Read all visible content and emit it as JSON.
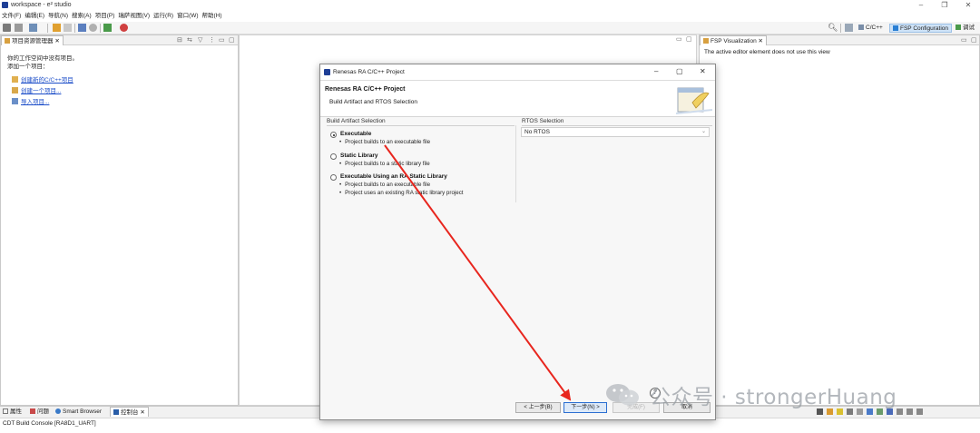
{
  "window": {
    "title": "workspace - e² studio"
  },
  "menu": [
    "文件(F)",
    "编辑(E)",
    "导航(N)",
    "搜索(A)",
    "项目(P)",
    "瑞萨视图(V)",
    "运行(R)",
    "窗口(W)",
    "帮助(H)"
  ],
  "perspectives": {
    "cpp": "C/C++",
    "fsp": "FSP Configuration",
    "debug": "调试"
  },
  "left_pane": {
    "tab": "项目资源管理器",
    "message1": "你的工作空间中没有项目。",
    "message2": "添加一个项目：",
    "links": [
      "创建新的C/C++项目",
      "创建一个项目...",
      "导入项目..."
    ]
  },
  "right_pane": {
    "tab": "FSP Visualization",
    "message": "The active editor element does not use this view"
  },
  "bottom_pane": {
    "tabs": [
      "属性",
      "问题",
      "Smart Browser",
      "控制台"
    ],
    "console": "CDT Build Console [RA8D1_UART]"
  },
  "dialog": {
    "title": "Renesas RA C/C++ Project",
    "banner_title": "Renesas RA C/C++ Project",
    "banner_subtitle": "Build Artifact and RTOS Selection",
    "artifact_group": "Build Artifact Selection",
    "rtos_group": "RTOS Selection",
    "rtos_value": "No RTOS",
    "options": [
      {
        "label": "Executable",
        "selected": true,
        "bullets": [
          "Project builds to an executable file"
        ]
      },
      {
        "label": "Static Library",
        "selected": false,
        "bullets": [
          "Project builds to a static library file"
        ]
      },
      {
        "label": "Executable Using an RA Static Library",
        "selected": false,
        "bullets": [
          "Project builds to an executable file",
          "Project uses an existing RA static library project"
        ]
      }
    ],
    "buttons": {
      "back": "< 上一步(B)",
      "next": "下一步(N) >",
      "finish": "完成(F)",
      "cancel": "取消"
    },
    "help": "?"
  },
  "watermark": {
    "text": "公众号 · strongerHuang"
  },
  "annotation": {
    "arrow_color": "#e8261e"
  }
}
